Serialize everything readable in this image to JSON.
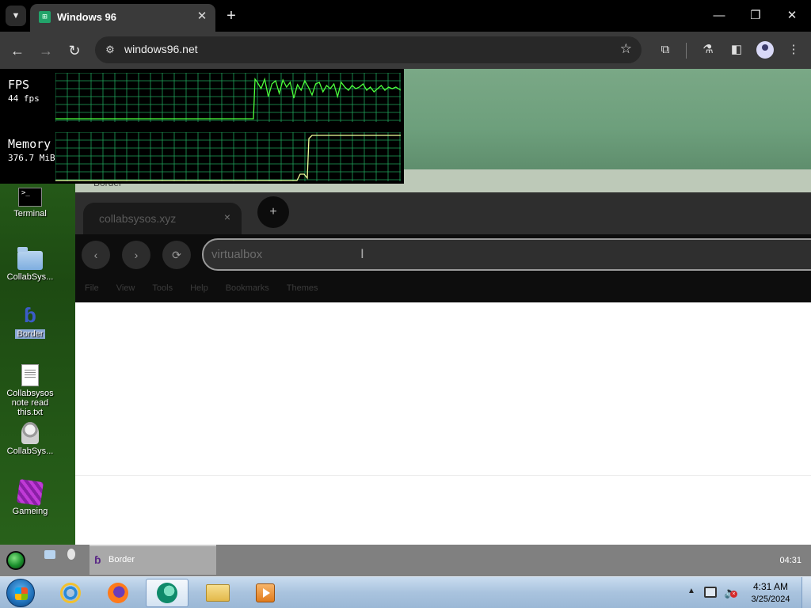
{
  "chrome": {
    "tab_title": "Windows 96",
    "favicon_letter": "⊞",
    "tab_close": "✕",
    "new_tab": "+",
    "minimize": "—",
    "restore": "❐",
    "close": "✕",
    "url": "windows96.net",
    "back": "←",
    "forward": "→",
    "reload": "↻",
    "menu": "⋮"
  },
  "perf": {
    "fps_label": "FPS",
    "fps_value": "44 fps",
    "memory_label": "Memory",
    "memory_value": "376.7 MiB",
    "grid_color": "#1fa35a",
    "fps_line_color": "#4cff3c",
    "memory_line_color": "#f0ff9a"
  },
  "page": {
    "under_label": "Border"
  },
  "desktop": {
    "icons": [
      {
        "label": "Terminal"
      },
      {
        "label": "CollabSys..."
      },
      {
        "label": "Border"
      },
      {
        "label": "Collabsysos note read this.txt"
      },
      {
        "label": "CollabSys..."
      },
      {
        "label": "Gameing"
      }
    ]
  },
  "border_browser": {
    "tab_title": "collabsysos.xyz",
    "tab_close": "×",
    "new_tab": "+",
    "back": "‹",
    "forward": "›",
    "reload": "⟳",
    "address_value": "virtualbox",
    "cursor_glyph": "I",
    "menu": [
      "File",
      "View",
      "Tools",
      "Help",
      "Bookmarks",
      "Themes"
    ]
  },
  "w96_taskbar": {
    "task_label": "Border",
    "task_icon": "ɓ",
    "clock": "04:31"
  },
  "win_taskbar": {
    "time": "4:31 AM",
    "date": "3/25/2024",
    "tray_chevron": "▲",
    "volume_icon": "🔈",
    "volume_muted": "×"
  }
}
